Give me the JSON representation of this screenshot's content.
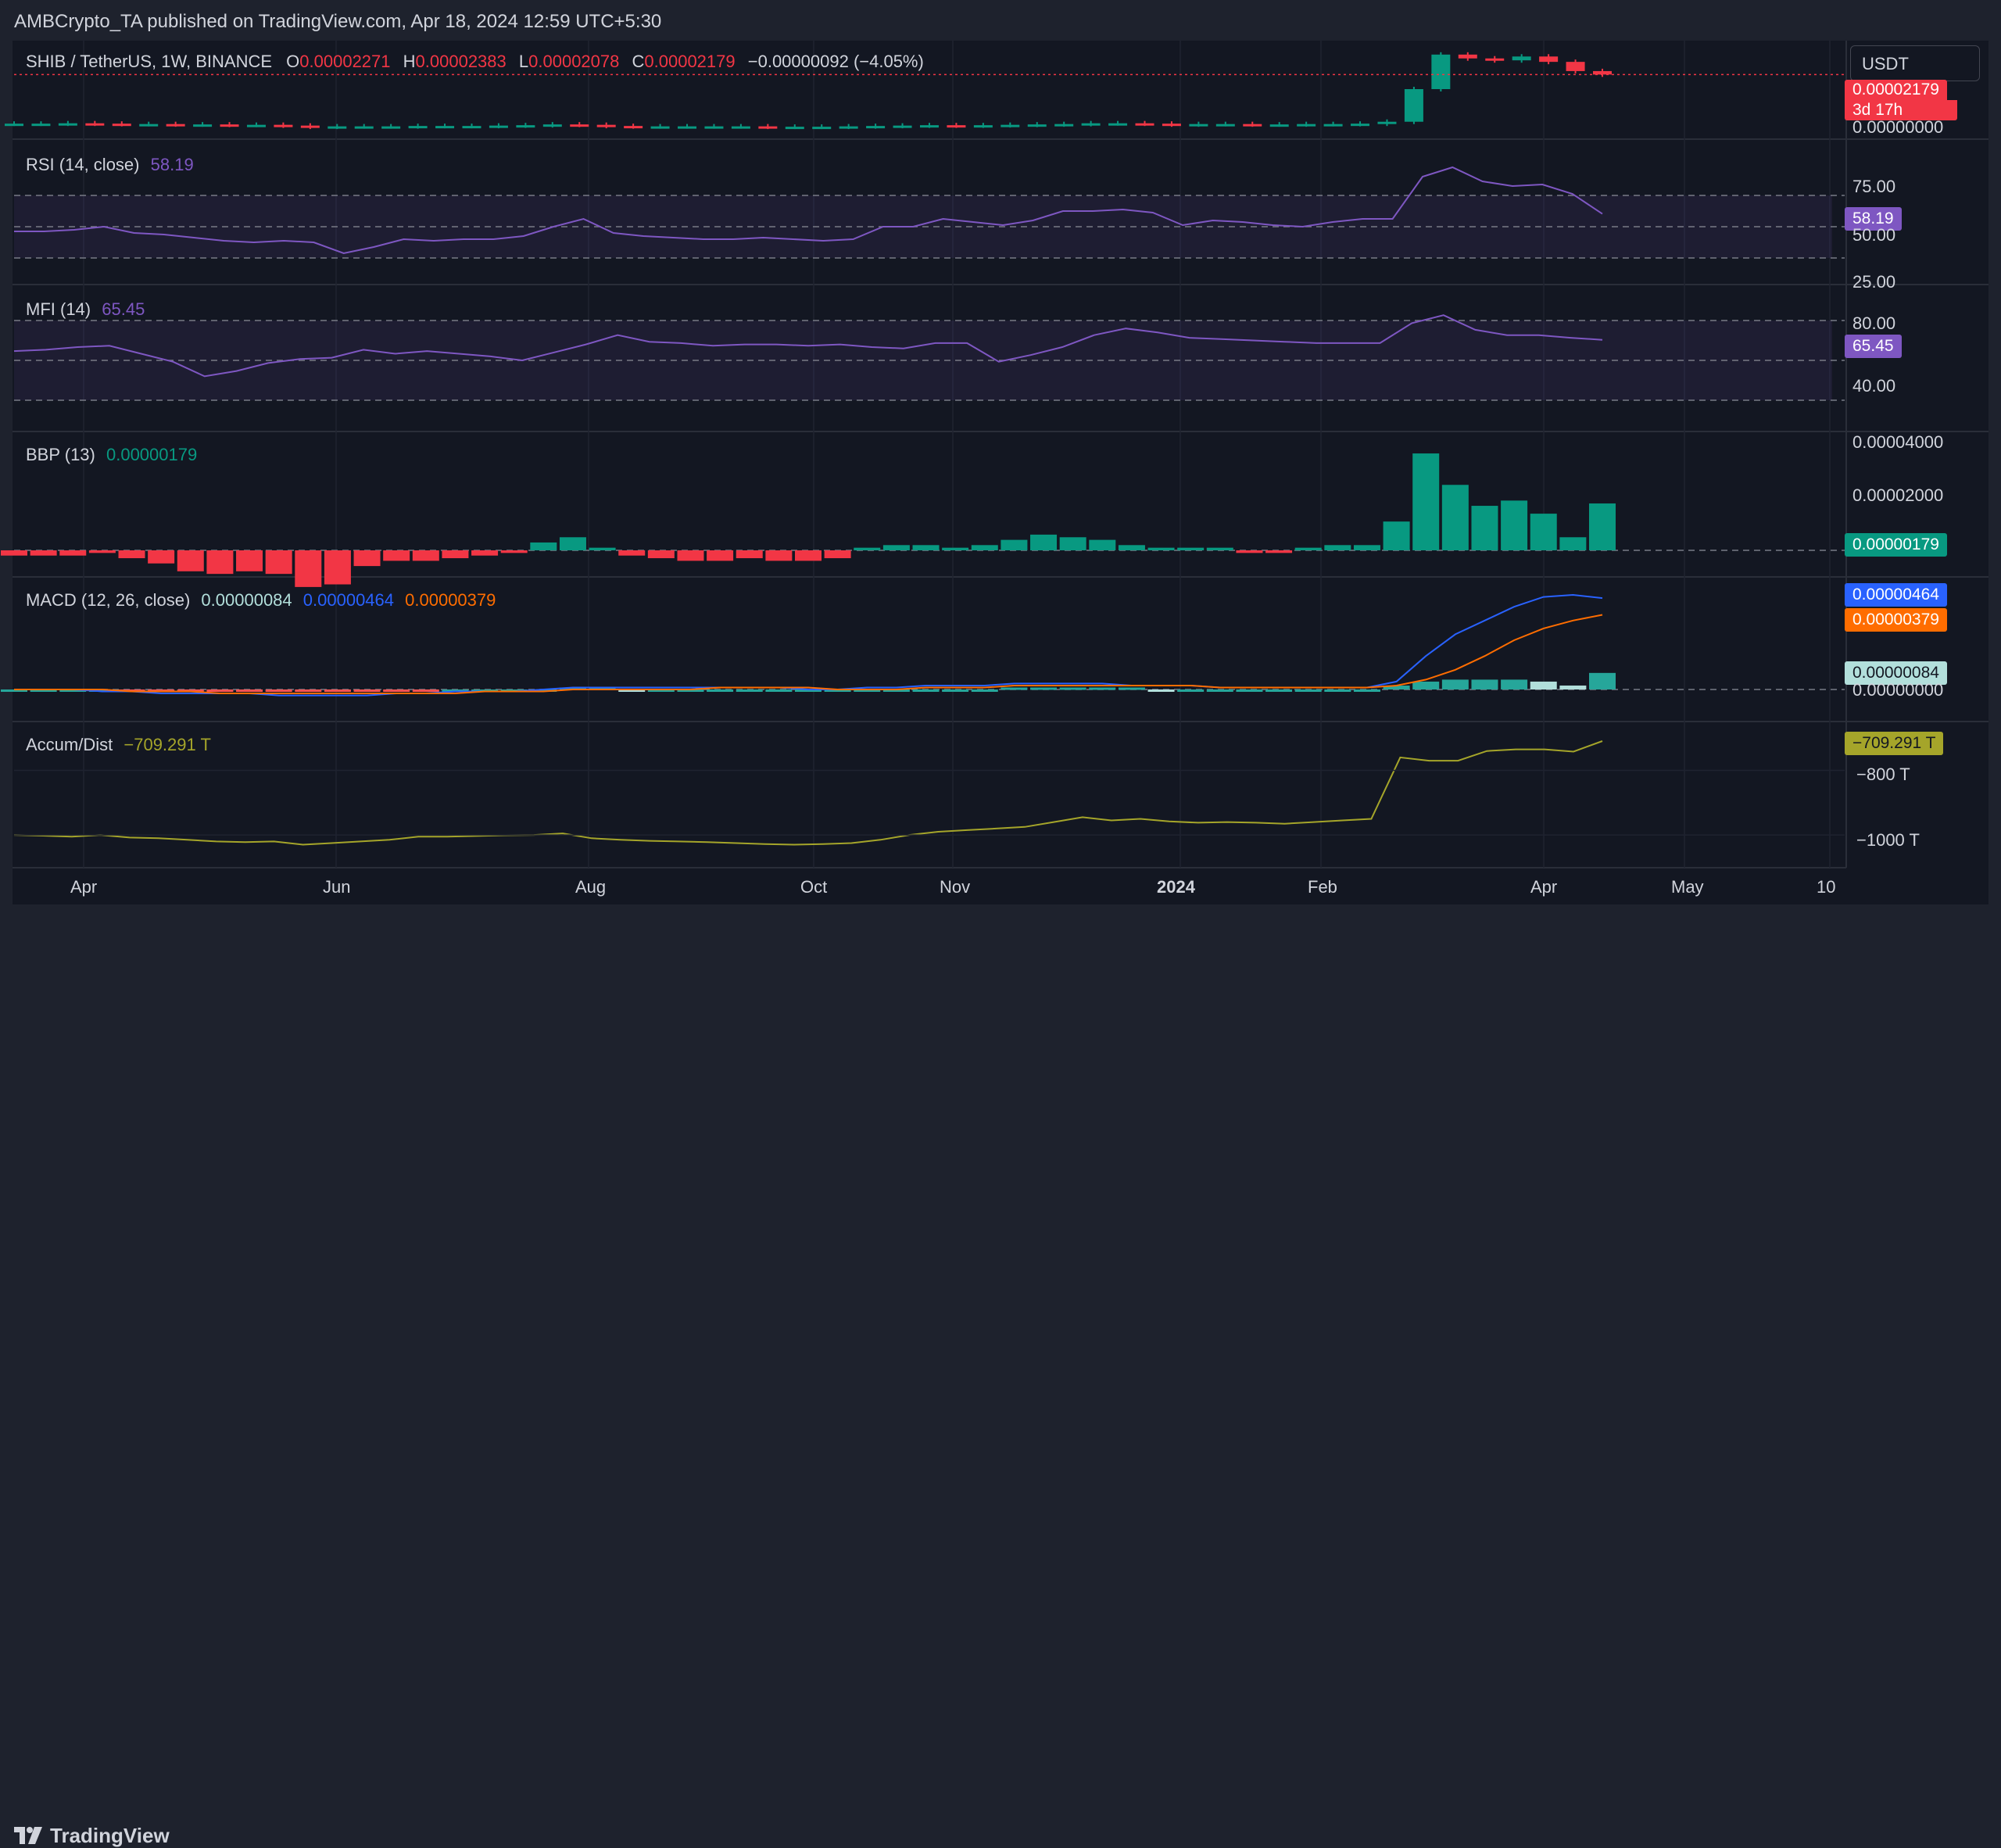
{
  "published_by": "AMBCrypto_TA published on TradingView.com, Apr 18, 2024 12:59 UTC+5:30",
  "logo_text": "TradingView",
  "currency_button": "USDT",
  "colors": {
    "up": "#089981",
    "down": "#f23645",
    "rsi": "#7e57c2",
    "macd": "#2962ff",
    "signal": "#ff6d00",
    "ad": "#a5a52a",
    "hist_light": "#b2dfdb"
  },
  "legend": {
    "symbol": "SHIB / TetherUS, 1W, BINANCE",
    "o_label": "O",
    "o_value": "0.00002271",
    "h_label": "H",
    "h_value": "0.00002383",
    "l_label": "L",
    "l_value": "0.00002078",
    "c_label": "C",
    "c_value": "0.00002179",
    "change": "−0.00000092 (−4.05%)",
    "rsi_title": "RSI (14, close)",
    "rsi_value": "58.19",
    "mfi_title": "MFI (14)",
    "mfi_value": "65.45",
    "bbp_title": "BBP (13)",
    "bbp_value": "0.00000179",
    "macd_title": "MACD (12, 26, close)",
    "macd_hist": "0.00000084",
    "macd_line": "0.00000464",
    "macd_signal": "0.00000379",
    "ad_title": "Accum/Dist",
    "ad_value": "−709.291 T"
  },
  "price_axis": {
    "last_price_tag": "0.00002179",
    "countdown_tag": "3d 17h",
    "zero_label": "0.00000000",
    "rsi_ticks": [
      "75.00",
      "50.00",
      "25.00"
    ],
    "rsi_tag": "58.19",
    "mfi_ticks": [
      "80.00",
      "40.00"
    ],
    "mfi_tag": "65.45",
    "bbp_ticks": [
      "0.00004000",
      "0.00002000"
    ],
    "bbp_tag": "0.00000179",
    "macd_tags": [
      "0.00000464",
      "0.00000379",
      "0.00000084"
    ],
    "macd_zero": "0.00000000",
    "ad_tag": "−709.291 T",
    "ad_ticks": [
      "−800 T",
      "−1000 T"
    ]
  },
  "time_axis": [
    "Apr",
    "Jun",
    "Aug",
    "Oct",
    "Nov",
    "2024",
    "Feb",
    "Apr",
    "May",
    "10"
  ],
  "chart_data": {
    "type": "line",
    "symbol": "SHIB/USDT",
    "interval": "1W",
    "price": {
      "close": [
        9e-06,
        9e-06,
        9.1e-06,
        9e-06,
        8.9e-06,
        8.9e-06,
        8.8e-06,
        8.8e-06,
        8.7e-06,
        8.7e-06,
        8.5e-06,
        8.2e-06,
        8.3e-06,
        8.3e-06,
        8.3e-06,
        8.4e-06,
        8.4e-06,
        8.4e-06,
        8.5e-06,
        8.6e-06,
        8.8e-06,
        8.7e-06,
        8.4e-06,
        8.3e-06,
        8.3e-06,
        8.3e-06,
        8.3e-06,
        8.3e-06,
        8.2e-06,
        8.2e-06,
        8.2e-06,
        8.3e-06,
        8.4e-06,
        8.5e-06,
        8.6e-06,
        8.5e-06,
        8.6e-06,
        8.7e-06,
        8.8e-06,
        8.9e-06,
        9.1e-06,
        9.1e-06,
        9e-06,
        8.8e-06,
        8.9e-06,
        8.9e-06,
        8.8e-06,
        8.8e-06,
        8.9e-06,
        8.9e-06,
        9e-06,
        9.5e-06,
        1.8e-05,
        2.7e-05,
        2.6e-05,
        2.55e-05,
        2.65e-05,
        2.51e-05,
        2.27e-05,
        2.18e-05
      ],
      "last": 2.179e-05
    },
    "rsi": [
      47,
      47,
      48,
      50,
      46,
      45,
      43,
      41,
      40,
      41,
      40,
      33,
      37,
      42,
      41,
      42,
      42,
      44,
      50,
      55,
      46,
      44,
      43,
      42,
      42,
      43,
      42,
      41,
      42,
      50,
      50,
      55,
      53,
      51,
      54,
      60,
      60,
      61,
      59,
      51,
      54,
      53,
      51,
      50,
      53,
      55,
      55,
      82,
      88,
      79,
      76,
      77,
      71,
      58.19
    ],
    "rsi_levels": [
      70,
      50,
      30
    ],
    "mfi": [
      57,
      58,
      60,
      61,
      55,
      49,
      38,
      42,
      48,
      51,
      52,
      58,
      55,
      57,
      55,
      53,
      50,
      56,
      62,
      69,
      64,
      63,
      61,
      62,
      62,
      61,
      62,
      60,
      59,
      63,
      63,
      49,
      54,
      60,
      69,
      74,
      71,
      67,
      66,
      65,
      64,
      63,
      63,
      63,
      78,
      84,
      73,
      69,
      69,
      67,
      65.45
    ],
    "mfi_levels": [
      80,
      50,
      20
    ],
    "bbp": [
      -2e-07,
      -2e-07,
      -2e-07,
      -1e-07,
      -3e-07,
      -5e-07,
      -8e-07,
      -9e-07,
      -8e-07,
      -9e-07,
      -1.4e-06,
      -1.3e-06,
      -6e-07,
      -4e-07,
      -4e-07,
      -3e-07,
      -2e-07,
      -1e-07,
      3e-07,
      5e-07,
      1e-07,
      -2e-07,
      -3e-07,
      -4e-07,
      -4e-07,
      -3e-07,
      -4e-07,
      -4e-07,
      -3e-07,
      1e-07,
      2e-07,
      2e-07,
      1e-07,
      2e-07,
      4e-07,
      6e-07,
      5e-07,
      4e-07,
      2e-07,
      1e-07,
      1e-07,
      1e-07,
      -1e-07,
      -1e-07,
      1e-07,
      2e-07,
      2e-07,
      1.1e-06,
      3.7e-06,
      2.5e-06,
      1.7e-06,
      1.9e-06,
      1.4e-06,
      5e-07,
      1.79e-06
    ],
    "macd_histogram": [
      0.0,
      0.0,
      0.0,
      0.0,
      -1e-07,
      -1e-07,
      -1e-07,
      -1e-07,
      -1e-07,
      -1e-07,
      -1e-07,
      -1e-07,
      -1e-07,
      -1e-07,
      -1e-07,
      0.0,
      0.0,
      0.0,
      0.0,
      1e-07,
      1e-07,
      0.0,
      0.0,
      0.0,
      0.0,
      0.0,
      0.0,
      0.0,
      0.0,
      0.0,
      0.0,
      0.0,
      0.0,
      0.0,
      1e-07,
      1e-07,
      1e-07,
      1e-07,
      1e-07,
      0.0,
      0.0,
      0.0,
      0.0,
      0.0,
      0.0,
      0.0,
      0.0,
      2e-07,
      4e-07,
      5e-07,
      5e-07,
      5e-07,
      4e-07,
      2e-07,
      8.4e-07
    ],
    "macd_line": [
      0.0,
      0.0,
      0.0,
      -1e-07,
      -1e-07,
      -2e-07,
      -2e-07,
      -2e-07,
      -2e-07,
      -3e-07,
      -3e-07,
      -3e-07,
      -3e-07,
      -2e-07,
      -2e-07,
      -1e-07,
      -1e-07,
      -1e-07,
      0.0,
      1e-07,
      1e-07,
      1e-07,
      1e-07,
      1e-07,
      1e-07,
      1e-07,
      1e-07,
      0.0,
      0.0,
      1e-07,
      1e-07,
      2e-07,
      2e-07,
      2e-07,
      3e-07,
      3e-07,
      3e-07,
      3e-07,
      2e-07,
      2e-07,
      2e-07,
      1e-07,
      1e-07,
      1e-07,
      1e-07,
      1e-07,
      1e-07,
      4e-07,
      1.7e-06,
      2.8e-06,
      3.5e-06,
      4.2e-06,
      4.7e-06,
      4.8e-06,
      4.64e-06
    ],
    "macd_signal": [
      0.0,
      0.0,
      0.0,
      0.0,
      -1e-07,
      -1e-07,
      -1e-07,
      -2e-07,
      -2e-07,
      -2e-07,
      -2e-07,
      -2e-07,
      -2e-07,
      -2e-07,
      -2e-07,
      -2e-07,
      -1e-07,
      -1e-07,
      -1e-07,
      0.0,
      0.0,
      0.0,
      0.0,
      0.0,
      1e-07,
      1e-07,
      1e-07,
      1e-07,
      0.0,
      0.0,
      0.0,
      1e-07,
      1e-07,
      1e-07,
      2e-07,
      2e-07,
      2e-07,
      2e-07,
      2e-07,
      2e-07,
      2e-07,
      1e-07,
      1e-07,
      1e-07,
      1e-07,
      1e-07,
      1e-07,
      2e-07,
      5e-07,
      1e-06,
      1.7e-06,
      2.5e-06,
      3.1e-06,
      3.5e-06,
      3.79e-06
    ],
    "accum_dist_T": [
      -1000,
      -1002,
      -1005,
      -1000,
      -1008,
      -1010,
      -1015,
      -1020,
      -1022,
      -1020,
      -1030,
      -1025,
      -1020,
      -1015,
      -1005,
      -1005,
      -1003,
      -1001,
      -1000,
      -995,
      -1010,
      -1015,
      -1018,
      -1020,
      -1022,
      -1025,
      -1028,
      -1030,
      -1028,
      -1025,
      -1015,
      -1000,
      -990,
      -985,
      -980,
      -975,
      -960,
      -945,
      -955,
      -950,
      -958,
      -962,
      -960,
      -962,
      -965,
      -960,
      -955,
      -950,
      -760,
      -770,
      -770,
      -740,
      -735,
      -735,
      -742,
      -709.291
    ]
  }
}
